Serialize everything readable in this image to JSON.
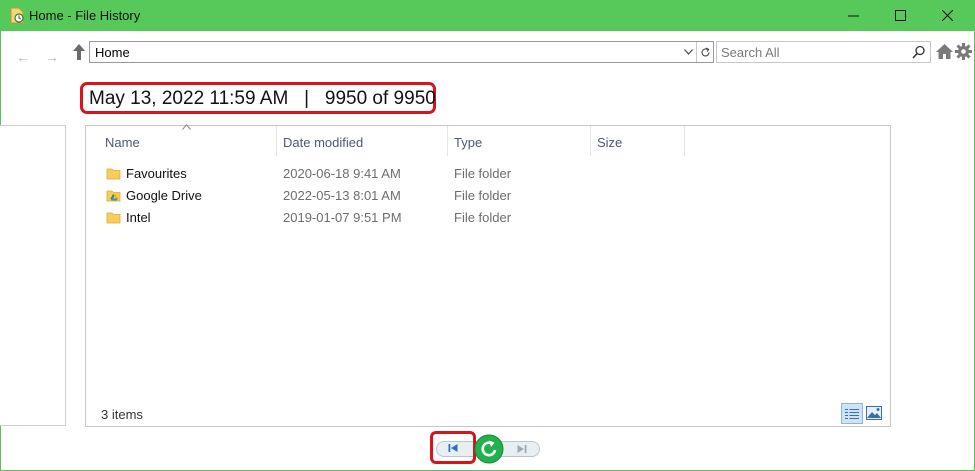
{
  "window": {
    "title": "Home - File History"
  },
  "nav": {
    "address": "Home",
    "search_placeholder": "Search All"
  },
  "snapshot": {
    "heading": "May 13, 2022 11:59 AM   |   9950 of 9950"
  },
  "columns": {
    "name": "Name",
    "date_modified": "Date modified",
    "type": "Type",
    "size": "Size"
  },
  "files": [
    {
      "name": "Favourites",
      "date_modified": "2020-06-18 9:41 AM",
      "type": "File folder",
      "icon": "folder-icon"
    },
    {
      "name": "Google Drive",
      "date_modified": "2022-05-13 8:01 AM",
      "type": "File folder",
      "icon": "google-drive-folder-icon"
    },
    {
      "name": "Intel",
      "date_modified": "2019-01-07 9:51 PM",
      "type": "File folder",
      "icon": "folder-icon"
    }
  ],
  "status": {
    "item_count": "3 items"
  },
  "colors": {
    "titlebar": "#57c95a",
    "highlight": "#d6141b",
    "restore": "#22b14c"
  }
}
